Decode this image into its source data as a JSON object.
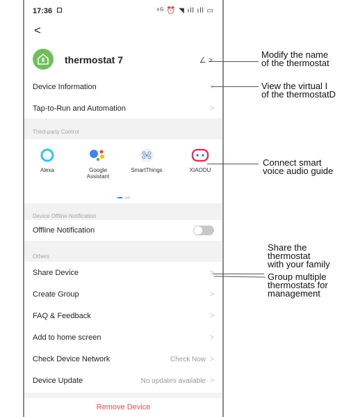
{
  "status_bar": {
    "time": "17:36",
    "icons": "⁴ᴳ ⏰ ◥ ıll ıll ▭"
  },
  "header": {
    "back_glyph": "<",
    "device_name": "thermostat 7",
    "edit_glyph": "∠ >"
  },
  "rows": {
    "device_information": "Device Information",
    "tap_to_run": "Tap-to-Run and Automation"
  },
  "third_party": {
    "section_label": "Third-party Control",
    "items": [
      {
        "label": "Alexa",
        "icon": "alexa-icon"
      },
      {
        "label": "Google Assistant",
        "icon": "google-assistant-icon"
      },
      {
        "label": "SmartThings",
        "icon": "smartthings-icon"
      },
      {
        "label": "XIAODU",
        "icon": "xiaodu-icon"
      }
    ]
  },
  "offline": {
    "section_label": "Device Offline Notification",
    "label": "Offline Notification",
    "enabled": false
  },
  "others": {
    "section_label": "Others",
    "share_device": "Share Device",
    "create_group": "Create Group",
    "faq": "FAQ & Feedback",
    "add_home": "Add to home screen",
    "check_network": "Check Device Network",
    "check_network_value": "Check Now",
    "device_update": "Device Update",
    "device_update_value": "No updates available"
  },
  "remove_label": "Remove Device",
  "chevron": ">",
  "annotations": {
    "modify_name": "Modify the name\nof the thermostat",
    "view_virtual_id": "View the virtual I\nof the thermostatD",
    "connect_voice": "Connect smart\nvoice audio guide",
    "share": "Share the\nthermostat\nwith your family",
    "group": "Group multiple\nthermostats for\nmanagement"
  },
  "colors": {
    "accent_blue": "#2f8cff",
    "remove_red": "#e84a4a",
    "device_green": "#6fbf5a"
  }
}
